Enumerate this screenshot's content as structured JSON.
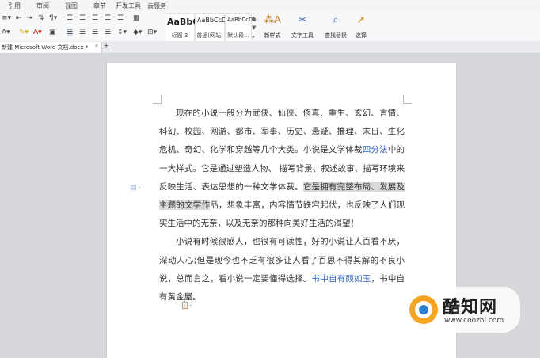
{
  "menu": [
    "引用",
    "审阅",
    "视图",
    "章节",
    "开发工具",
    "云服务"
  ],
  "ribbon": {
    "styles": [
      {
        "sample": "AaBbC",
        "label": "标题 3"
      },
      {
        "sample": "AaBbCcDd",
        "label": "普通(网站)"
      },
      {
        "sample": "AaBbCcDc",
        "label": "默认段..."
      }
    ],
    "new_style_label": "新样式",
    "text_tool_label": "文字工具",
    "find_replace_label": "查找替换",
    "select_label": "选择"
  },
  "tabs": {
    "doc_title": "新建 Microsoft Word 文档.docx *",
    "close": "×",
    "new_tab": "+"
  },
  "document": {
    "p1": {
      "a": "现在的小说一般分为武侠、仙侠、修真、重生、玄幻、言情、科幻、校园、网游、都市、军事、历史、悬疑、推理、末日、生化危机、奇幻、化学和穿越等几个大类。小说是文学体裁",
      "link": "四分法",
      "b": "中的一大样式。它是通过塑造人物、 描写背景、叙述故事、描写环境来反映生活、表达思想的一种文学体裁。",
      "highlight": "它是拥有完整布局、发展及主题的文学作",
      "c": "品，想象丰富，内容情节跌宕起伏，也反映了人们现实生活中的无奈，以及无奈的那种向美好生活的渴望！"
    },
    "p2": {
      "a": "小说有时候很感人，也很有可读性，好的小说让人百看不厌，深动人心;但是现今也不乏有很多让人看了百思不得其解的不良小说，总而言之，看小说一定要懂得选择。",
      "link": "书中自有颜如玉",
      "b": "，书中自有黄金屋。"
    }
  },
  "watermark": {
    "title": "酷知网",
    "url": "www.coozhi.com"
  }
}
